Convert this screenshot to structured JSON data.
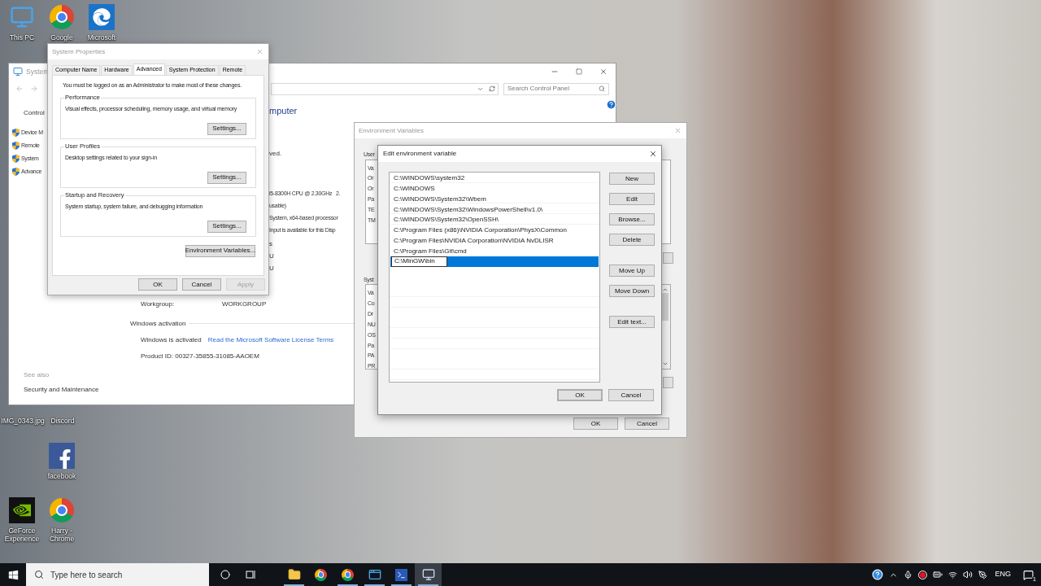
{
  "desktop_icons": [
    {
      "label": "This PC",
      "kind": "pc"
    },
    {
      "label": "Google",
      "kind": "chrome"
    },
    {
      "label": "Microsoft",
      "kind": "edge"
    },
    {
      "label": "IMG_0343.jpg",
      "kind": "label_only"
    },
    {
      "label": "Discord",
      "kind": "label_only"
    },
    {
      "label": "facebook",
      "kind": "facebook"
    },
    {
      "label": "GeForce Experience",
      "kind": "nvidia"
    },
    {
      "label": "Harry - Chrome",
      "kind": "chrome"
    }
  ],
  "system_window": {
    "title": "System",
    "search": {
      "placeholder": "Search Control Panel"
    },
    "nav_heading": "Control",
    "nav_items": [
      "Device M",
      "Remote",
      "System",
      "Advance"
    ],
    "heading": "mputer",
    "rights_text": "ved.",
    "specs": [
      "i5-8300H CPU @ 2.30GHz   2.",
      "usable)",
      "System, x64-based processor",
      "Input is available for this Disp"
    ],
    "section_cut": "s",
    "cut_values": [
      "U",
      "U"
    ],
    "workgroup": {
      "label": "Workgroup:",
      "value": "WORKGROUP"
    },
    "activation": {
      "heading": "Windows activation",
      "status": "Windows is activated",
      "link": "Read the Microsoft Software License Terms",
      "product_id": "Product ID: 00327-35855-31085-AAOEM"
    },
    "see_also": {
      "heading": "See also",
      "items": [
        "Security and Maintenance"
      ]
    }
  },
  "system_properties": {
    "title": "System Properties",
    "tabs": [
      {
        "label": "Computer Name",
        "selected": false
      },
      {
        "label": "Hardware",
        "selected": false
      },
      {
        "label": "Advanced",
        "selected": true
      },
      {
        "label": "System Protection",
        "selected": false
      },
      {
        "label": "Remote",
        "selected": false
      }
    ],
    "notice": "You must be logged on as an Administrator to make most of these changes.",
    "groups": [
      {
        "title": "Performance",
        "description": "Visual effects, processor scheduling, memory usage, and virtual memory",
        "button": "Settings..."
      },
      {
        "title": "User Profiles",
        "description": "Desktop settings related to your sign-in",
        "button": "Settings..."
      },
      {
        "title": "Startup and Recovery",
        "description": "System startup, system failure, and debugging information",
        "button": "Settings..."
      }
    ],
    "env_button": "Environment Variables...",
    "buttons": [
      {
        "label": "OK",
        "disabled": false
      },
      {
        "label": "Cancel",
        "disabled": false
      },
      {
        "label": "Apply",
        "disabled": true
      }
    ]
  },
  "environment_variables": {
    "title": "Environment Variables",
    "user_label": "User",
    "user_cut": [
      "Va",
      "Or",
      "Or",
      "Pa",
      "TE",
      "TM"
    ],
    "system_label": "Syst",
    "system_cut": [
      "Va",
      "Co",
      "Dr",
      "NU",
      "OS",
      "Pa",
      "PA",
      "PR"
    ],
    "buttons": [
      "OK",
      "Cancel"
    ]
  },
  "edit_dialog": {
    "title": "Edit environment variable",
    "entries": [
      {
        "value": "C:\\WINDOWS\\system32",
        "selected": false
      },
      {
        "value": "C:\\WINDOWS",
        "selected": false
      },
      {
        "value": "C:\\WINDOWS\\System32\\Wbem",
        "selected": false
      },
      {
        "value": "C:\\WINDOWS\\System32\\WindowsPowerShell\\v1.0\\",
        "selected": false
      },
      {
        "value": "C:\\WINDOWS\\System32\\OpenSSH\\",
        "selected": false
      },
      {
        "value": "C:\\Program Files (x86)\\NVIDIA Corporation\\PhysX\\Common",
        "selected": false
      },
      {
        "value": "C:\\Program Files\\NVIDIA Corporation\\NVIDIA NvDLISR",
        "selected": false
      },
      {
        "value": "C:\\Program Files\\Git\\cmd",
        "selected": false
      },
      {
        "value": "C:\\MinGW\\bin",
        "selected": true
      }
    ],
    "button_groups": [
      {
        "buttons": [
          "New",
          "Edit",
          "Browse...",
          "Delete"
        ]
      },
      {
        "buttons": [
          "Move Up",
          "Move Down"
        ]
      },
      {
        "buttons": [
          "Edit text..."
        ]
      }
    ],
    "buttons": [
      {
        "label": "OK",
        "default": true
      },
      {
        "label": "Cancel",
        "default": false
      }
    ]
  },
  "taskbar": {
    "search": {
      "placeholder": "Type here to search"
    },
    "apps": [
      {
        "kind": "folder",
        "running": true,
        "selected": false
      },
      {
        "kind": "chrome",
        "running": false,
        "selected": false
      },
      {
        "kind": "chrome",
        "running": true,
        "selected": false
      },
      {
        "kind": "window",
        "running": true,
        "selected": false
      },
      {
        "kind": "terminal",
        "running": true,
        "selected": false
      },
      {
        "kind": "monitor",
        "running": true,
        "selected": true
      }
    ],
    "language": "ENG",
    "notification_count": "1"
  }
}
